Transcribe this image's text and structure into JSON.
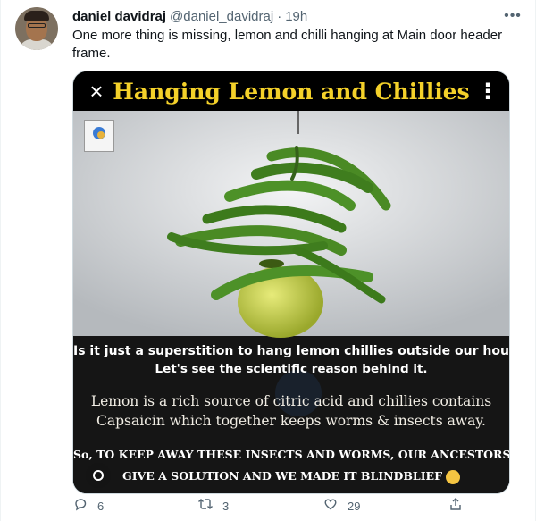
{
  "tweet": {
    "author_name": "daniel davidraj",
    "author_handle": "@daniel_davidraj",
    "separator": "·",
    "time": "19h",
    "text": "One more thing is missing, lemon and chilli hanging at Main door header frame."
  },
  "media": {
    "title": "Hanging Lemon and Chillies",
    "question_line1": "Is it just a superstition to hang lemon chillies outside our houses??",
    "question_line2": "Let's see the scientific reason behind it.",
    "body_line1": "Lemon is a rich source of citric acid and chillies contains",
    "body_line2": "Capsaicin  which together keeps worms & insects away.",
    "conclusion_prefix": "So,",
    "conclusion_line1": "TO KEEP AWAY THESE INSECTS AND WORMS, OUR ANCESTORS",
    "conclusion_line2": "GIVE A SOLUTION AND WE MADE IT BLINDBLIEF",
    "title_color": "#f4d12a"
  },
  "actions": {
    "reply_count": "6",
    "retweet_count": "3",
    "like_count": "29"
  },
  "icons": {
    "close": "close-icon",
    "more": "more-options-icon",
    "reply": "reply-icon",
    "retweet": "retweet-icon",
    "like": "heart-icon",
    "share": "share-icon",
    "lens": "lens-icon"
  },
  "colors": {
    "text_primary": "#0f1419",
    "text_secondary": "#536471",
    "border": "#cfd9de"
  }
}
